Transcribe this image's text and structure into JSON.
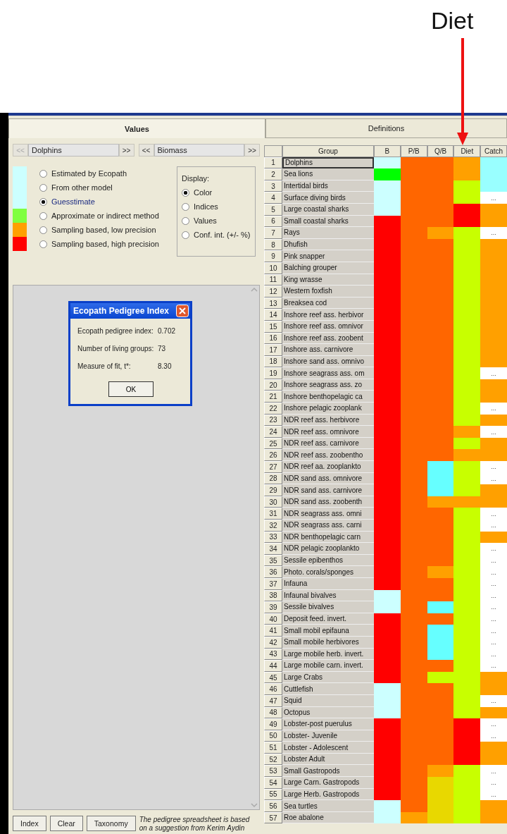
{
  "annotation": {
    "label": "Diet"
  },
  "tabs": [
    {
      "label": "Values",
      "selected": true
    },
    {
      "label": "Definitions",
      "selected": false
    }
  ],
  "navigators": [
    {
      "prev": "<<",
      "value": "Dolphins",
      "next": ">>",
      "prev_disabled": true
    },
    {
      "prev": "<<",
      "value": "Biomass",
      "next": ">>",
      "prev_disabled": false
    }
  ],
  "legend": [
    {
      "label": "Estimated by Ecopath",
      "color": "#ccffff",
      "selected": false
    },
    {
      "label": "From other model",
      "color": "#ccffff",
      "selected": false
    },
    {
      "label": "Guesstimate",
      "color": "#ccffff",
      "selected": true
    },
    {
      "label": "Approximate or indirect method",
      "color": "#80ff40",
      "selected": false
    },
    {
      "label": "Sampling based, low precision",
      "color": "#ffa000",
      "selected": false
    },
    {
      "label": "Sampling based, high precision",
      "color": "#ff0000",
      "selected": false
    }
  ],
  "display": {
    "title": "Display:",
    "options": [
      {
        "label": "Color",
        "selected": true
      },
      {
        "label": "Indices",
        "selected": false
      },
      {
        "label": "Values",
        "selected": false
      },
      {
        "label": "Conf. int. (+/- %)",
        "selected": false
      }
    ]
  },
  "dialog": {
    "title": "Ecopath Pedigree Index",
    "rows": [
      {
        "label": "Ecopath pedigree index:",
        "value": "0.702"
      },
      {
        "label": "Number of living groups:",
        "value": "73"
      },
      {
        "label": "Measure of fit, t*:",
        "value": "8.30"
      }
    ],
    "button": "OK"
  },
  "buttons": [
    "Index",
    "Clear",
    "Taxonomy"
  ],
  "note": "The pedigree spreadsheet is based on a suggestion from Kerim Aydin",
  "table": {
    "columns": [
      "Group",
      "B",
      "P/B",
      "Q/B",
      "Diet",
      "Catch"
    ],
    "rows": [
      {
        "number": "1",
        "group": "Dolphins",
        "selected": true,
        "cells": [
          {
            "color": "#ccffff"
          },
          {
            "color": "#ff6600"
          },
          {
            "color": "#ff6600"
          },
          {
            "color": "#ffa000"
          },
          {
            "color": "#99ffff"
          }
        ]
      },
      {
        "number": "2",
        "group": "Sea lions",
        "selected": false,
        "cells": [
          {
            "color": "#00ff00"
          },
          {
            "color": "#ff6600"
          },
          {
            "color": "#ff6600"
          },
          {
            "color": "#ffa000"
          },
          {
            "color": "#99ffff"
          }
        ]
      },
      {
        "number": "3",
        "group": "Intertidal birds",
        "selected": false,
        "cells": [
          {
            "color": "#ccffff"
          },
          {
            "color": "#ff6600"
          },
          {
            "color": "#ff6600"
          },
          {
            "color": "#c8ff00"
          },
          {
            "color": "#99ffff"
          }
        ]
      },
      {
        "number": "4",
        "group": "Surface diving birds",
        "selected": false,
        "cells": [
          {
            "color": "#ccffff"
          },
          {
            "color": "#ff6600"
          },
          {
            "color": "#ff6600"
          },
          {
            "color": "#c8ff00"
          },
          {
            "color": "#ffffff",
            "text": "..."
          }
        ]
      },
      {
        "number": "5",
        "group": "Large coastal sharks",
        "selected": false,
        "cells": [
          {
            "color": "#ccffff"
          },
          {
            "color": "#ff6600"
          },
          {
            "color": "#ff6600"
          },
          {
            "color": "#ff0000"
          },
          {
            "color": "#ffa000"
          }
        ]
      },
      {
        "number": "6",
        "group": "Small coastal sharks",
        "selected": false,
        "cells": [
          {
            "color": "#ff0000"
          },
          {
            "color": "#ff6600"
          },
          {
            "color": "#ff6600"
          },
          {
            "color": "#ff0000"
          },
          {
            "color": "#ffa000"
          }
        ]
      },
      {
        "number": "7",
        "group": "Rays",
        "selected": false,
        "cells": [
          {
            "color": "#ff0000"
          },
          {
            "color": "#ff6600"
          },
          {
            "color": "#ffa000"
          },
          {
            "color": "#c8ff00"
          },
          {
            "color": "#ffffff",
            "text": "..."
          }
        ]
      },
      {
        "number": "8",
        "group": "Dhufish",
        "selected": false,
        "cells": [
          {
            "color": "#ff0000"
          },
          {
            "color": "#ff6600"
          },
          {
            "color": "#ff6600"
          },
          {
            "color": "#c8ff00"
          },
          {
            "color": "#ffa000"
          }
        ]
      },
      {
        "number": "9",
        "group": "Pink snapper",
        "selected": false,
        "cells": [
          {
            "color": "#ff0000"
          },
          {
            "color": "#ff6600"
          },
          {
            "color": "#ff6600"
          },
          {
            "color": "#c8ff00"
          },
          {
            "color": "#ffa000"
          }
        ]
      },
      {
        "number": "10",
        "group": "Balching grouper",
        "selected": false,
        "cells": [
          {
            "color": "#ff0000"
          },
          {
            "color": "#ff6600"
          },
          {
            "color": "#ff6600"
          },
          {
            "color": "#c8ff00"
          },
          {
            "color": "#ffa000"
          }
        ]
      },
      {
        "number": "11",
        "group": "King wrasse",
        "selected": false,
        "cells": [
          {
            "color": "#ff0000"
          },
          {
            "color": "#ff6600"
          },
          {
            "color": "#ff6600"
          },
          {
            "color": "#c8ff00"
          },
          {
            "color": "#ffa000"
          }
        ]
      },
      {
        "number": "12",
        "group": "Western foxfish",
        "selected": false,
        "cells": [
          {
            "color": "#ff0000"
          },
          {
            "color": "#ff6600"
          },
          {
            "color": "#ff6600"
          },
          {
            "color": "#c8ff00"
          },
          {
            "color": "#ffa000"
          }
        ]
      },
      {
        "number": "13",
        "group": "Breaksea cod",
        "selected": false,
        "cells": [
          {
            "color": "#ff0000"
          },
          {
            "color": "#ff6600"
          },
          {
            "color": "#ff6600"
          },
          {
            "color": "#c8ff00"
          },
          {
            "color": "#ffa000"
          }
        ]
      },
      {
        "number": "14",
        "group": "Inshore reef ass. herbivor",
        "selected": false,
        "cells": [
          {
            "color": "#ff0000"
          },
          {
            "color": "#ff6600"
          },
          {
            "color": "#ff6600"
          },
          {
            "color": "#c8ff00"
          },
          {
            "color": "#ffa000"
          }
        ]
      },
      {
        "number": "15",
        "group": "Inshore reef ass. omnivor",
        "selected": false,
        "cells": [
          {
            "color": "#ff0000"
          },
          {
            "color": "#ff6600"
          },
          {
            "color": "#ff6600"
          },
          {
            "color": "#c8ff00"
          },
          {
            "color": "#ffa000"
          }
        ]
      },
      {
        "number": "16",
        "group": "Inshore reef ass. zoobent",
        "selected": false,
        "cells": [
          {
            "color": "#ff0000"
          },
          {
            "color": "#ff6600"
          },
          {
            "color": "#ff6600"
          },
          {
            "color": "#c8ff00"
          },
          {
            "color": "#ffa000"
          }
        ]
      },
      {
        "number": "17",
        "group": "Inshore ass. carnivore",
        "selected": false,
        "cells": [
          {
            "color": "#ff0000"
          },
          {
            "color": "#ff6600"
          },
          {
            "color": "#ff6600"
          },
          {
            "color": "#c8ff00"
          },
          {
            "color": "#ffa000"
          }
        ]
      },
      {
        "number": "18",
        "group": "Inshore sand ass. omnivo",
        "selected": false,
        "cells": [
          {
            "color": "#ff0000"
          },
          {
            "color": "#ff6600"
          },
          {
            "color": "#ff6600"
          },
          {
            "color": "#c8ff00"
          },
          {
            "color": "#ffa000"
          }
        ]
      },
      {
        "number": "19",
        "group": "Inshore seagrass ass. om",
        "selected": false,
        "cells": [
          {
            "color": "#ff0000"
          },
          {
            "color": "#ff6600"
          },
          {
            "color": "#ff6600"
          },
          {
            "color": "#c8ff00"
          },
          {
            "color": "#ffffff",
            "text": "..."
          }
        ]
      },
      {
        "number": "20",
        "group": "Inshore seagrass ass. zo",
        "selected": false,
        "cells": [
          {
            "color": "#ff0000"
          },
          {
            "color": "#ff6600"
          },
          {
            "color": "#ff6600"
          },
          {
            "color": "#c8ff00"
          },
          {
            "color": "#ffa000"
          }
        ]
      },
      {
        "number": "21",
        "group": "Inshore benthopelagic ca",
        "selected": false,
        "cells": [
          {
            "color": "#ff0000"
          },
          {
            "color": "#ff6600"
          },
          {
            "color": "#ff6600"
          },
          {
            "color": "#c8ff00"
          },
          {
            "color": "#ffa000"
          }
        ]
      },
      {
        "number": "22",
        "group": "Inshore pelagic zooplank",
        "selected": false,
        "cells": [
          {
            "color": "#ff0000"
          },
          {
            "color": "#ff6600"
          },
          {
            "color": "#ff6600"
          },
          {
            "color": "#c8ff00"
          },
          {
            "color": "#ffffff",
            "text": "..."
          }
        ]
      },
      {
        "number": "23",
        "group": "NDR reef ass. herbivore",
        "selected": false,
        "cells": [
          {
            "color": "#ff0000"
          },
          {
            "color": "#ff6600"
          },
          {
            "color": "#ff6600"
          },
          {
            "color": "#c8ff00"
          },
          {
            "color": "#ffa000"
          }
        ]
      },
      {
        "number": "24",
        "group": "NDR reef ass. omnivore",
        "selected": false,
        "cells": [
          {
            "color": "#ff0000"
          },
          {
            "color": "#ff6600"
          },
          {
            "color": "#ff6600"
          },
          {
            "color": "#ffa000"
          },
          {
            "color": "#ffffff",
            "text": "..."
          }
        ]
      },
      {
        "number": "25",
        "group": "NDR reef ass. carnivore",
        "selected": false,
        "cells": [
          {
            "color": "#ff0000"
          },
          {
            "color": "#ff6600"
          },
          {
            "color": "#ff6600"
          },
          {
            "color": "#c8ff00"
          },
          {
            "color": "#ffa000"
          }
        ]
      },
      {
        "number": "26",
        "group": "NDR reef ass. zoobentho",
        "selected": false,
        "cells": [
          {
            "color": "#ff0000"
          },
          {
            "color": "#ff6600"
          },
          {
            "color": "#ff6600"
          },
          {
            "color": "#ffa000"
          },
          {
            "color": "#ffa000"
          }
        ]
      },
      {
        "number": "27",
        "group": "NDR reef aa. zooplankto",
        "selected": false,
        "cells": [
          {
            "color": "#ff0000"
          },
          {
            "color": "#ff6600"
          },
          {
            "color": "#66ffff"
          },
          {
            "color": "#c8ff00"
          },
          {
            "color": "#ffffff",
            "text": "..."
          }
        ]
      },
      {
        "number": "28",
        "group": "NDR sand ass. omnivore",
        "selected": false,
        "cells": [
          {
            "color": "#ff0000"
          },
          {
            "color": "#ff6600"
          },
          {
            "color": "#66ffff"
          },
          {
            "color": "#c8ff00"
          },
          {
            "color": "#ffffff",
            "text": "..."
          }
        ]
      },
      {
        "number": "29",
        "group": "NDR sand ass. carnivore",
        "selected": false,
        "cells": [
          {
            "color": "#ff0000"
          },
          {
            "color": "#ff6600"
          },
          {
            "color": "#66ffff"
          },
          {
            "color": "#c8ff00"
          },
          {
            "color": "#ffa000"
          }
        ]
      },
      {
        "number": "30",
        "group": "NDR sand ass. zoobenth",
        "selected": false,
        "cells": [
          {
            "color": "#ff0000"
          },
          {
            "color": "#ff6600"
          },
          {
            "color": "#ffa000"
          },
          {
            "color": "#ffa000"
          },
          {
            "color": "#ffa000"
          }
        ]
      },
      {
        "number": "31",
        "group": "NDR seagrass ass. omni",
        "selected": false,
        "cells": [
          {
            "color": "#ff0000"
          },
          {
            "color": "#ff6600"
          },
          {
            "color": "#ff6600"
          },
          {
            "color": "#c8ff00"
          },
          {
            "color": "#ffffff",
            "text": "..."
          }
        ]
      },
      {
        "number": "32",
        "group": "NDR seagrass ass. carni",
        "selected": false,
        "cells": [
          {
            "color": "#ff0000"
          },
          {
            "color": "#ff6600"
          },
          {
            "color": "#ff6600"
          },
          {
            "color": "#c8ff00"
          },
          {
            "color": "#ffffff",
            "text": "..."
          }
        ]
      },
      {
        "number": "33",
        "group": "NDR benthopelagic carn",
        "selected": false,
        "cells": [
          {
            "color": "#ff0000"
          },
          {
            "color": "#ff6600"
          },
          {
            "color": "#ff6600"
          },
          {
            "color": "#c8ff00"
          },
          {
            "color": "#ffa000"
          }
        ]
      },
      {
        "number": "34",
        "group": "NDR pelagic zooplankto",
        "selected": false,
        "cells": [
          {
            "color": "#ff0000"
          },
          {
            "color": "#ff6600"
          },
          {
            "color": "#ff6600"
          },
          {
            "color": "#c8ff00"
          },
          {
            "color": "#ffffff",
            "text": "..."
          }
        ]
      },
      {
        "number": "35",
        "group": "Sessile epibenthos",
        "selected": false,
        "cells": [
          {
            "color": "#ff0000"
          },
          {
            "color": "#ff6600"
          },
          {
            "color": "#ff6600"
          },
          {
            "color": "#c8ff00"
          },
          {
            "color": "#ffffff",
            "text": "..."
          }
        ]
      },
      {
        "number": "36",
        "group": "Photo. corals/sponges",
        "selected": false,
        "cells": [
          {
            "color": "#ff0000"
          },
          {
            "color": "#ff6600"
          },
          {
            "color": "#ffa000"
          },
          {
            "color": "#c8ff00"
          },
          {
            "color": "#ffffff",
            "text": "..."
          }
        ]
      },
      {
        "number": "37",
        "group": "Infauna",
        "selected": false,
        "cells": [
          {
            "color": "#ff0000"
          },
          {
            "color": "#ff6600"
          },
          {
            "color": "#ff6600"
          },
          {
            "color": "#c8ff00"
          },
          {
            "color": "#ffffff",
            "text": "..."
          }
        ]
      },
      {
        "number": "38",
        "group": "Infaunal bivalves",
        "selected": false,
        "cells": [
          {
            "color": "#ccffff"
          },
          {
            "color": "#ff6600"
          },
          {
            "color": "#ff6600"
          },
          {
            "color": "#c8ff00"
          },
          {
            "color": "#ffffff",
            "text": "..."
          }
        ]
      },
      {
        "number": "39",
        "group": "Sessile bivalves",
        "selected": false,
        "cells": [
          {
            "color": "#ccffff"
          },
          {
            "color": "#ff6600"
          },
          {
            "color": "#66ffff"
          },
          {
            "color": "#c8ff00"
          },
          {
            "color": "#ffffff",
            "text": "..."
          }
        ]
      },
      {
        "number": "40",
        "group": "Deposit feed. invert.",
        "selected": false,
        "cells": [
          {
            "color": "#ff0000"
          },
          {
            "color": "#ff6600"
          },
          {
            "color": "#ff6600"
          },
          {
            "color": "#c8ff00"
          },
          {
            "color": "#ffffff",
            "text": "..."
          }
        ]
      },
      {
        "number": "41",
        "group": "Small mobil epifauna",
        "selected": false,
        "cells": [
          {
            "color": "#ff0000"
          },
          {
            "color": "#ff6600"
          },
          {
            "color": "#66ffff"
          },
          {
            "color": "#c8ff00"
          },
          {
            "color": "#ffffff",
            "text": "..."
          }
        ]
      },
      {
        "number": "42",
        "group": "Small mobile herbivores",
        "selected": false,
        "cells": [
          {
            "color": "#ff0000"
          },
          {
            "color": "#ff6600"
          },
          {
            "color": "#66ffff"
          },
          {
            "color": "#c8ff00"
          },
          {
            "color": "#ffffff",
            "text": "..."
          }
        ]
      },
      {
        "number": "43",
        "group": "Large mobile herb. invert.",
        "selected": false,
        "cells": [
          {
            "color": "#ff0000"
          },
          {
            "color": "#ff6600"
          },
          {
            "color": "#66ffff"
          },
          {
            "color": "#c8ff00"
          },
          {
            "color": "#ffffff",
            "text": "..."
          }
        ]
      },
      {
        "number": "44",
        "group": "Large mobile carn. invert.",
        "selected": false,
        "cells": [
          {
            "color": "#ff0000"
          },
          {
            "color": "#ff6600"
          },
          {
            "color": "#ff6600"
          },
          {
            "color": "#c8ff00"
          },
          {
            "color": "#ffffff",
            "text": "..."
          }
        ]
      },
      {
        "number": "45",
        "group": "Large Crabs",
        "selected": false,
        "cells": [
          {
            "color": "#ff0000"
          },
          {
            "color": "#ff6600"
          },
          {
            "color": "#c8ff00"
          },
          {
            "color": "#c8ff00"
          },
          {
            "color": "#ffa000"
          }
        ]
      },
      {
        "number": "46",
        "group": "Cuttlefish",
        "selected": false,
        "cells": [
          {
            "color": "#ccffff"
          },
          {
            "color": "#ff6600"
          },
          {
            "color": "#ff6600"
          },
          {
            "color": "#c8ff00"
          },
          {
            "color": "#ffa000"
          }
        ]
      },
      {
        "number": "47",
        "group": "Squid",
        "selected": false,
        "cells": [
          {
            "color": "#ccffff"
          },
          {
            "color": "#ff6600"
          },
          {
            "color": "#ff6600"
          },
          {
            "color": "#c8ff00"
          },
          {
            "color": "#ffffff",
            "text": "..."
          }
        ]
      },
      {
        "number": "48",
        "group": "Octopus",
        "selected": false,
        "cells": [
          {
            "color": "#ccffff"
          },
          {
            "color": "#ff6600"
          },
          {
            "color": "#ff6600"
          },
          {
            "color": "#c8ff00"
          },
          {
            "color": "#ffa000"
          }
        ]
      },
      {
        "number": "49",
        "group": "Lobster-post puerulus",
        "selected": false,
        "cells": [
          {
            "color": "#ff0000"
          },
          {
            "color": "#ff6600"
          },
          {
            "color": "#ff6600"
          },
          {
            "color": "#ff0000"
          },
          {
            "color": "#ffffff",
            "text": "..."
          }
        ]
      },
      {
        "number": "50",
        "group": "Lobster- Juvenile",
        "selected": false,
        "cells": [
          {
            "color": "#ff0000"
          },
          {
            "color": "#ff6600"
          },
          {
            "color": "#ff6600"
          },
          {
            "color": "#ff0000"
          },
          {
            "color": "#ffffff",
            "text": "..."
          }
        ]
      },
      {
        "number": "51",
        "group": "Lobster - Adolescent",
        "selected": false,
        "cells": [
          {
            "color": "#ff0000"
          },
          {
            "color": "#ff6600"
          },
          {
            "color": "#ff6600"
          },
          {
            "color": "#ff0000"
          },
          {
            "color": "#ffa000"
          }
        ]
      },
      {
        "number": "52",
        "group": "Lobster Adult",
        "selected": false,
        "cells": [
          {
            "color": "#ff0000"
          },
          {
            "color": "#ff6600"
          },
          {
            "color": "#ff6600"
          },
          {
            "color": "#ff0000"
          },
          {
            "color": "#ffa000"
          }
        ]
      },
      {
        "number": "53",
        "group": "Small Gastropods",
        "selected": false,
        "cells": [
          {
            "color": "#ff0000"
          },
          {
            "color": "#ff6600"
          },
          {
            "color": "#ffa000"
          },
          {
            "color": "#c8ff00"
          },
          {
            "color": "#ffffff",
            "text": "..."
          }
        ]
      },
      {
        "number": "54",
        "group": "Large Carn. Gastropods",
        "selected": false,
        "cells": [
          {
            "color": "#ff0000"
          },
          {
            "color": "#ff6600"
          },
          {
            "color": "#e8d800"
          },
          {
            "color": "#c8ff00"
          },
          {
            "color": "#ffffff",
            "text": "..."
          }
        ]
      },
      {
        "number": "55",
        "group": "Large Herb. Gastropods",
        "selected": false,
        "cells": [
          {
            "color": "#ff0000"
          },
          {
            "color": "#ff6600"
          },
          {
            "color": "#e8d800"
          },
          {
            "color": "#c8ff00"
          },
          {
            "color": "#ffffff",
            "text": "..."
          }
        ]
      },
      {
        "number": "56",
        "group": "Sea turtles",
        "selected": false,
        "cells": [
          {
            "color": "#ccffff"
          },
          {
            "color": "#ff6600"
          },
          {
            "color": "#e8d800"
          },
          {
            "color": "#c8ff00"
          },
          {
            "color": "#ffa000"
          }
        ]
      },
      {
        "number": "57",
        "group": "Roe abalone",
        "selected": false,
        "cells": [
          {
            "color": "#ccffff"
          },
          {
            "color": "#ffa000"
          },
          {
            "color": "#e8d800"
          },
          {
            "color": "#c8ff00"
          },
          {
            "color": "#ffa000"
          }
        ]
      }
    ]
  }
}
